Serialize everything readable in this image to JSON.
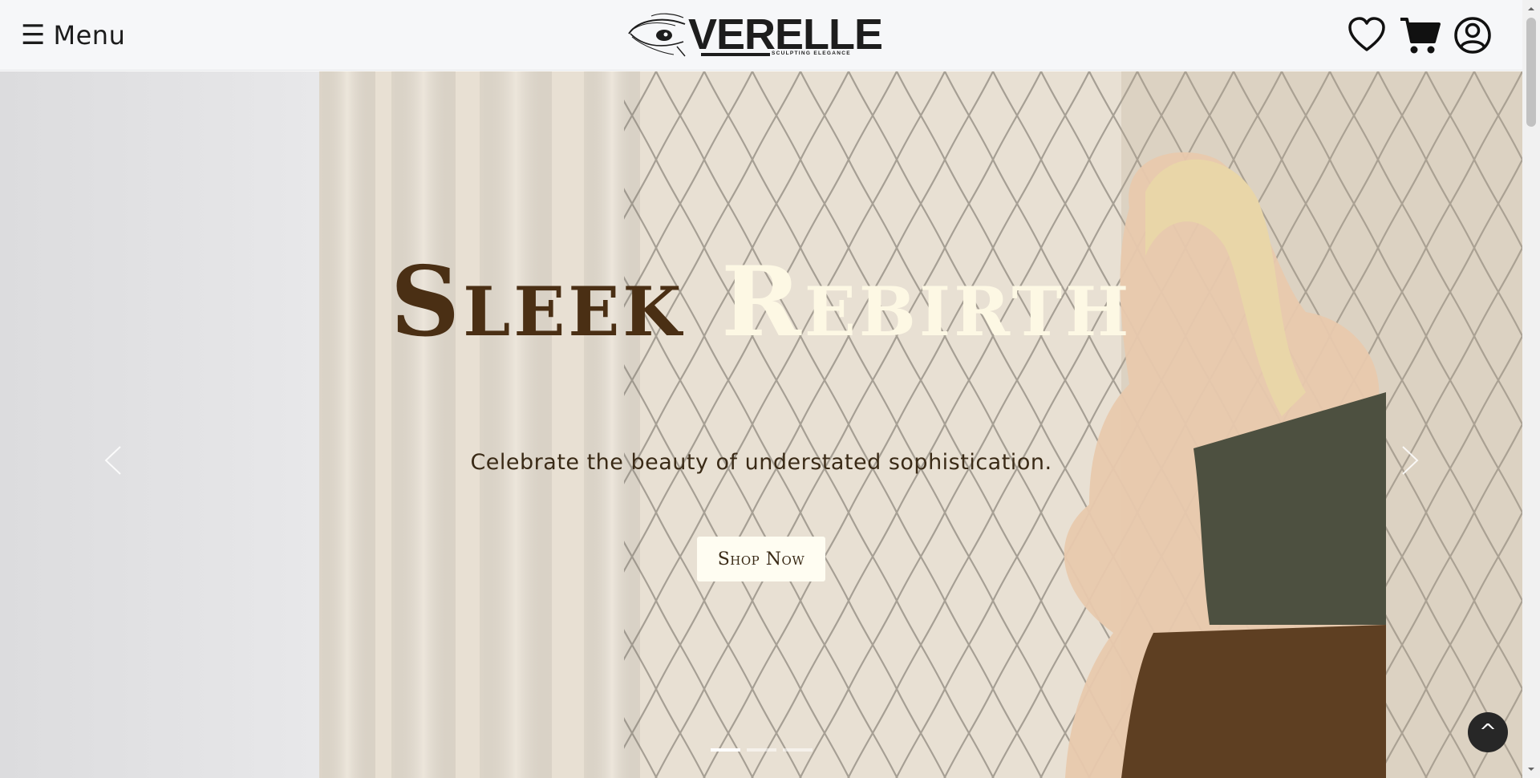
{
  "header": {
    "menu_icon": "hamburger-icon",
    "menu_label": "Menu",
    "logo": {
      "brand": "VERELLE",
      "tagline": "SCULPTING ELEGANCE"
    },
    "icons": [
      "heart-icon",
      "cart-icon",
      "account-icon"
    ]
  },
  "hero": {
    "title_part1": "Sleek",
    "title_part2": "Rebirth",
    "subtitle": "Celebrate the beauty of understated sophistication.",
    "cta_label": "Shop Now",
    "prev_icon": "chevron-left-icon",
    "next_icon": "chevron-right-icon",
    "slides_count": 3,
    "active_slide": 1
  },
  "back_to_top": {
    "label": "^"
  },
  "colors": {
    "title_dark": "#4a2f14",
    "title_light": "#fdf8e4",
    "header_bg": "#f6f7f9",
    "button_bg": "#fffdf2"
  }
}
